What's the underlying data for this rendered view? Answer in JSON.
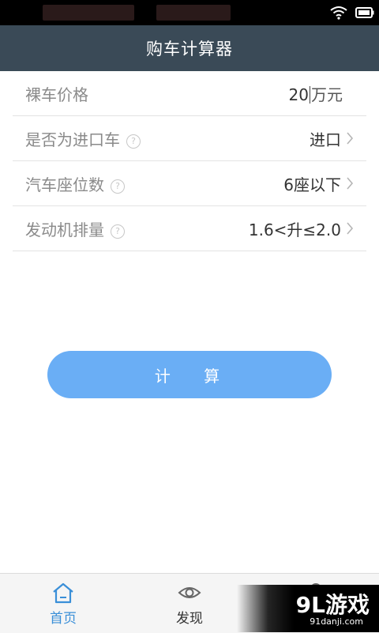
{
  "header": {
    "title": "购车计算器"
  },
  "form": {
    "price": {
      "label": "裸车价格",
      "value": "20",
      "unit": "万元"
    },
    "imported": {
      "label": "是否为进口车",
      "value": "进口"
    },
    "seats": {
      "label": "汽车座位数",
      "value": "6座以下"
    },
    "engine": {
      "label": "发动机排量",
      "value": "1.6<升≤2.0"
    }
  },
  "help_glyph": "?",
  "calculate_label": "计 算",
  "tabs": [
    {
      "label": "首页",
      "icon": "home-icon",
      "active": true
    },
    {
      "label": "发现",
      "icon": "eye-icon",
      "active": false
    }
  ],
  "watermark": {
    "main": "9L游戏",
    "sub": "91danji.com"
  },
  "colors": {
    "titlebar": "#3a4a57",
    "accent": "#6aaef5",
    "active_tab": "#3a8fd8"
  }
}
